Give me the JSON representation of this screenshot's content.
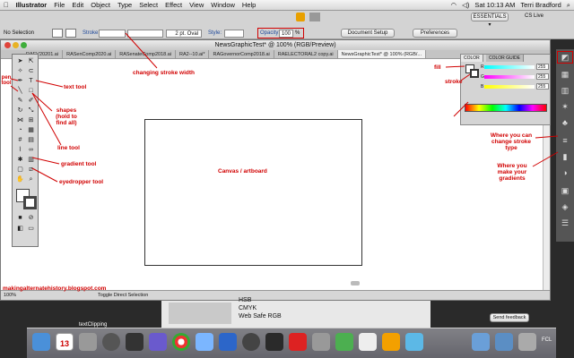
{
  "menubar": {
    "apple": "",
    "app_name": "Illustrator",
    "items": [
      "File",
      "Edit",
      "Object",
      "Type",
      "Select",
      "Effect",
      "View",
      "Window",
      "Help"
    ],
    "essentials": "ESSENTIALS ▾",
    "cs_live": "CS Live",
    "clock": "Sat 10:13 AM",
    "user": "Terri Bradford"
  },
  "control_bar": {
    "selection": "No Selection",
    "stroke_label": "Stroke:",
    "brush": "2 pt. Oval",
    "style_label": "Style:",
    "opacity_label": "Opacity:",
    "opacity_value": "100",
    "opacity_unit": "%",
    "document_setup": "Document Setup",
    "preferences": "Preferences"
  },
  "document": {
    "title": "NewsGraphicTest* @ 100% (RGB/Preview)",
    "tabs": [
      "RAEV20201.ai",
      "RASenComp2020.ai",
      "RASenateComp2018.ai",
      "RA2--10.ai*",
      "RAGovernorComp2018.ai",
      "RAELECTORAL2 copy.ai",
      "NewsGraphicTest* @ 100% (RGB/..."
    ],
    "active_tab": 6,
    "status_zoom": "100%",
    "status_tool": "Toggle Direct Selection",
    "watermark": "makingalternatehistory.blogspot.com"
  },
  "color_panel": {
    "tabs": [
      "COLOR",
      "COLOR GUIDE"
    ],
    "channels": [
      {
        "label": "R",
        "value": "255"
      },
      {
        "label": "G",
        "value": "255"
      },
      {
        "label": "B",
        "value": "255"
      }
    ]
  },
  "behind_window": {
    "items": [
      "HSB",
      "CMYK",
      "Web Safe RGB"
    ],
    "send_feedback": "Send feedback"
  },
  "dock": {
    "clipping_label": "textClipping",
    "calendar_day": "13",
    "fcl_label": "FCL"
  },
  "annotations": {
    "stroke_width": "changing stroke width",
    "fill": "fill",
    "stroke": "stroke",
    "pen_tool": "pen tool",
    "text_tool": "text tool",
    "shapes": "shapes (hold to find all)",
    "line_tool": "line tool",
    "gradient_tool": "gradient tool",
    "eyedropper_tool": "eyedropper tool",
    "canvas": "Canvas / artboard",
    "stroke_type": "Where you can change stroke type",
    "gradients": "Where you make your gradients"
  },
  "colors": {
    "annotation_red": "#d10000",
    "menubar_bg": "#e6e6e6",
    "desktop_bg": "#2a2a2a"
  }
}
